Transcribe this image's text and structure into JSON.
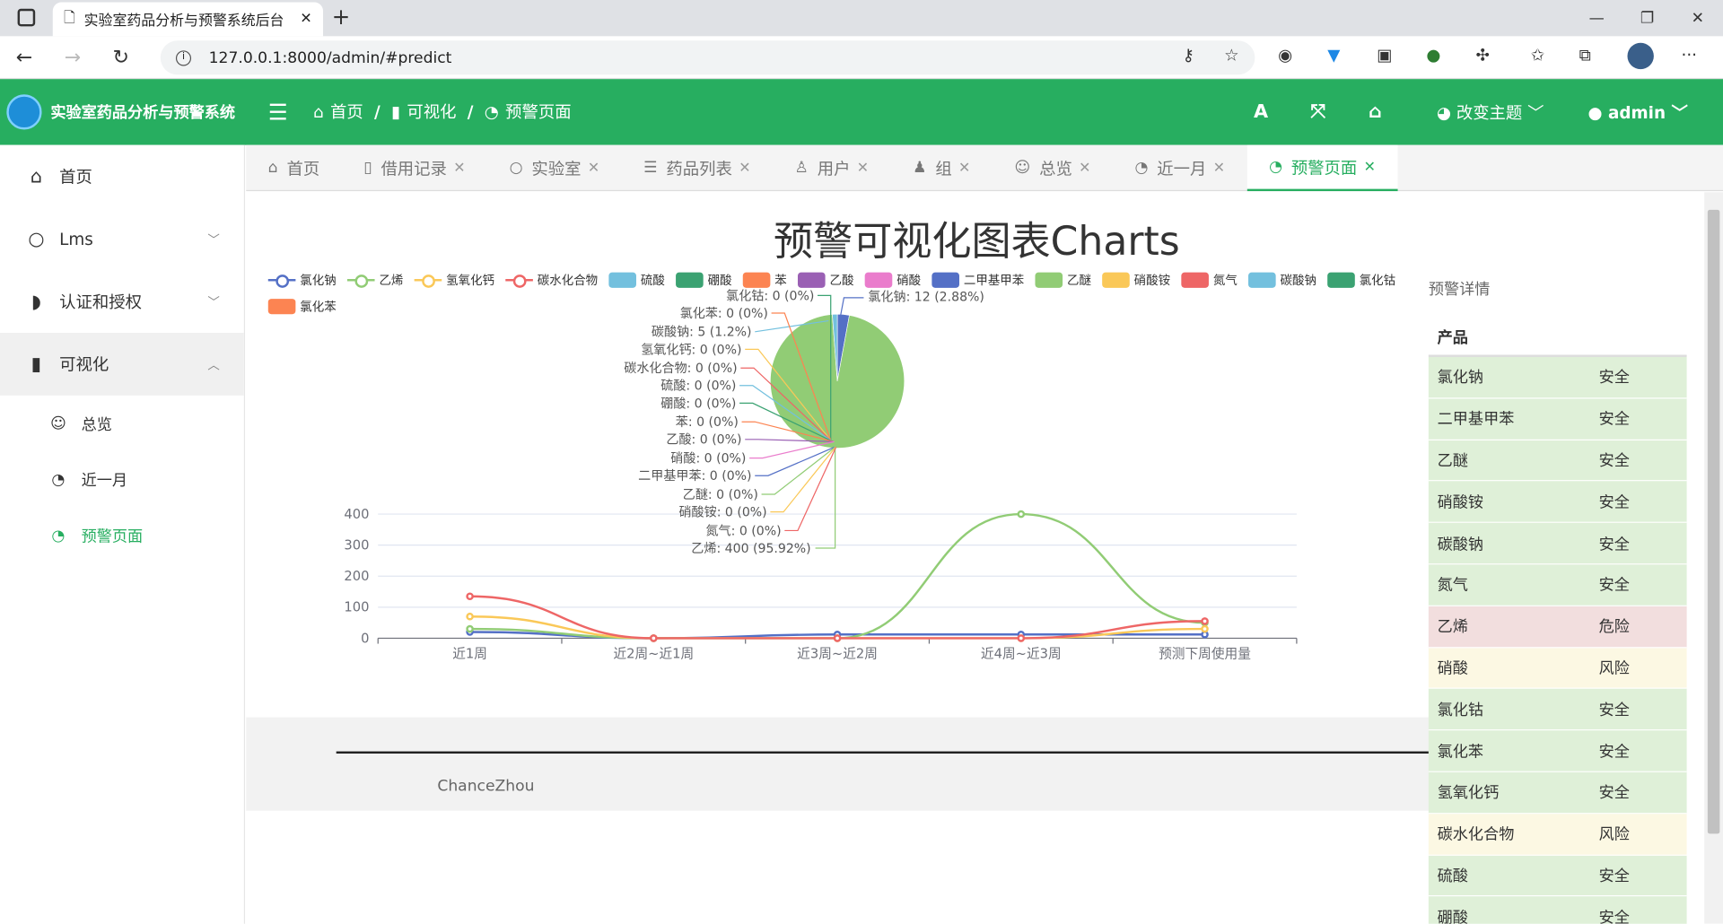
{
  "browser": {
    "tab_title": "实验室药品分析与预警系统后台",
    "url": "127.0.0.1:8000/admin/#predict"
  },
  "header": {
    "app_name": "实验室药品分析与预警系统",
    "breadcrumb": [
      "首页",
      "可视化",
      "预警页面"
    ],
    "theme_label": "改变主题",
    "user": "admin"
  },
  "sidebar": {
    "items": [
      {
        "label": "首页",
        "icon": "home-icon"
      },
      {
        "label": "Lms",
        "icon": "circle-icon"
      },
      {
        "label": "认证和授权",
        "icon": "shield-icon"
      },
      {
        "label": "可视化",
        "icon": "file-icon"
      }
    ],
    "sub": [
      {
        "label": "总览",
        "icon": "smile-icon"
      },
      {
        "label": "近一月",
        "icon": "github-icon"
      },
      {
        "label": "预警页面",
        "icon": "github-icon"
      }
    ]
  },
  "tabs": [
    "首页",
    "借用记录",
    "实验室",
    "药品列表",
    "用户",
    "组",
    "总览",
    "近一月",
    "预警页面"
  ],
  "footer": {
    "copyright": "ChanceZhou"
  },
  "warning": {
    "title": "预警详情",
    "col_product": "产品",
    "rows": [
      {
        "name": "氯化钠",
        "status": "安全",
        "level": "safe"
      },
      {
        "name": "二甲基甲苯",
        "status": "安全",
        "level": "safe"
      },
      {
        "name": "乙醚",
        "status": "安全",
        "level": "safe"
      },
      {
        "name": "硝酸铵",
        "status": "安全",
        "level": "safe"
      },
      {
        "name": "碳酸钠",
        "status": "安全",
        "level": "safe"
      },
      {
        "name": "氮气",
        "status": "安全",
        "level": "safe"
      },
      {
        "name": "乙烯",
        "status": "危险",
        "level": "danger"
      },
      {
        "name": "硝酸",
        "status": "风险",
        "level": "risk"
      },
      {
        "name": "氯化钴",
        "status": "安全",
        "level": "safe"
      },
      {
        "name": "氯化苯",
        "status": "安全",
        "level": "safe"
      },
      {
        "name": "氢氧化钙",
        "status": "安全",
        "level": "safe"
      },
      {
        "name": "碳水化合物",
        "status": "风险",
        "level": "risk"
      },
      {
        "name": "硫酸",
        "status": "安全",
        "level": "safe"
      },
      {
        "name": "硼酸",
        "status": "安全",
        "level": "safe"
      }
    ]
  },
  "chart_data": [
    {
      "type": "line",
      "title": "预警可视化图表Charts",
      "categories": [
        "近1周",
        "近2周~近1周",
        "近3周~近2周",
        "近4周~近3周",
        "预测下周使用量"
      ],
      "ylim": [
        0,
        400
      ],
      "yticks": [
        0,
        100,
        200,
        300,
        400
      ],
      "series": [
        {
          "name": "氯化钠",
          "color": "#5470c6",
          "values": [
            20,
            0,
            12,
            12,
            12
          ]
        },
        {
          "name": "乙烯",
          "color": "#91cc75",
          "values": [
            30,
            0,
            0,
            400,
            50
          ]
        },
        {
          "name": "氢氧化钙",
          "color": "#fac858",
          "values": [
            70,
            0,
            0,
            0,
            30
          ]
        },
        {
          "name": "碳水化合物",
          "color": "#ee6666",
          "values": [
            135,
            0,
            0,
            0,
            55
          ]
        }
      ]
    },
    {
      "type": "pie",
      "slices": [
        {
          "label": "氯化钠: 12 (2.88%)",
          "value": 12,
          "color": "#5470c6"
        },
        {
          "label": "乙烯: 400 (95.92%)",
          "value": 400,
          "color": "#91cc75"
        },
        {
          "label": "碳酸钠: 5 (1.2%)",
          "value": 5,
          "color": "#73c0de"
        }
      ],
      "zero_labels": [
        "氯化钴: 0 (0%)",
        "氯化苯: 0 (0%)",
        "氢氧化钙: 0 (0%)",
        "碳水化合物: 0 (0%)",
        "硫酸: 0 (0%)",
        "硼酸: 0 (0%)",
        "苯: 0 (0%)",
        "乙酸: 0 (0%)",
        "硝酸: 0 (0%)",
        "二甲基甲苯: 0 (0%)",
        "乙醚: 0 (0%)",
        "硝酸铵: 0 (0%)",
        "氮气: 0 (0%)"
      ]
    }
  ],
  "legend": [
    {
      "name": "氯化钠",
      "color": "#5470c6",
      "kind": "line"
    },
    {
      "name": "乙烯",
      "color": "#91cc75",
      "kind": "line"
    },
    {
      "name": "氢氧化钙",
      "color": "#fac858",
      "kind": "line"
    },
    {
      "name": "碳水化合物",
      "color": "#ee6666",
      "kind": "line"
    },
    {
      "name": "硫酸",
      "color": "#73c0de",
      "kind": "box"
    },
    {
      "name": "硼酸",
      "color": "#3ba272",
      "kind": "box"
    },
    {
      "name": "苯",
      "color": "#fc8452",
      "kind": "box"
    },
    {
      "name": "乙酸",
      "color": "#9a60b4",
      "kind": "box"
    },
    {
      "name": "硝酸",
      "color": "#ea7ccc",
      "kind": "box"
    },
    {
      "name": "二甲基甲苯",
      "color": "#5470c6",
      "kind": "box"
    },
    {
      "name": "乙醚",
      "color": "#91cc75",
      "kind": "box"
    },
    {
      "name": "硝酸铵",
      "color": "#fac858",
      "kind": "box"
    },
    {
      "name": "氮气",
      "color": "#ee6666",
      "kind": "box"
    },
    {
      "name": "碳酸钠",
      "color": "#73c0de",
      "kind": "box"
    },
    {
      "name": "氯化钴",
      "color": "#3ba272",
      "kind": "box"
    },
    {
      "name": "氯化苯",
      "color": "#fc8452",
      "kind": "box"
    }
  ]
}
